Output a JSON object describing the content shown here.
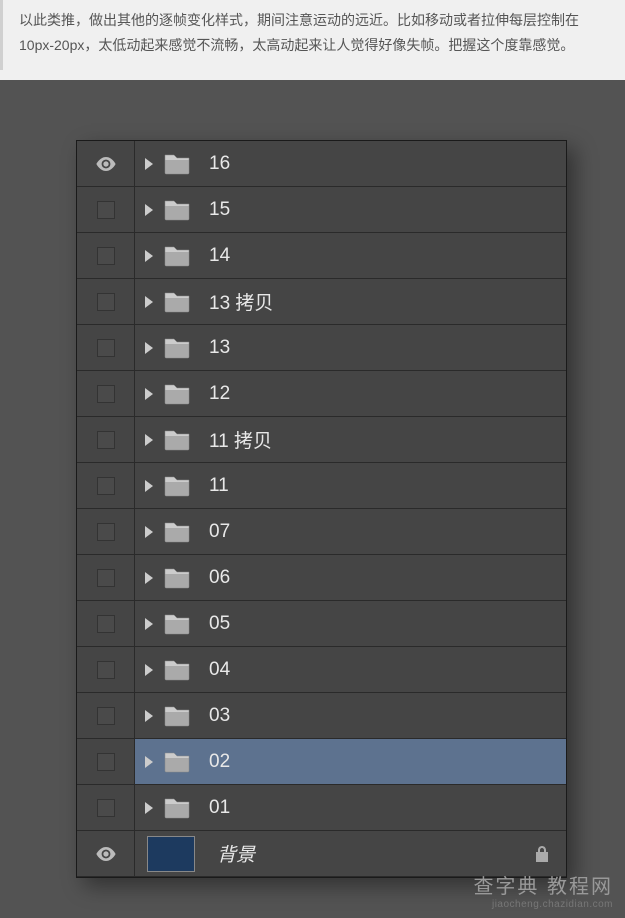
{
  "article": {
    "text": "以此类推，做出其他的逐帧变化样式，期间注意运动的远近。比如移动或者拉伸每层控制在10px-20px，太低动起来感觉不流畅，太高动起来让人觉得好像失帧。把握这个度靠感觉。"
  },
  "layers": [
    {
      "visible": true,
      "name": "16",
      "selected": false,
      "type": "folder"
    },
    {
      "visible": false,
      "name": "15",
      "selected": false,
      "type": "folder"
    },
    {
      "visible": false,
      "name": "14",
      "selected": false,
      "type": "folder"
    },
    {
      "visible": false,
      "name": "13 拷贝",
      "selected": false,
      "type": "folder"
    },
    {
      "visible": false,
      "name": "13",
      "selected": false,
      "type": "folder"
    },
    {
      "visible": false,
      "name": "12",
      "selected": false,
      "type": "folder"
    },
    {
      "visible": false,
      "name": "11 拷贝",
      "selected": false,
      "type": "folder"
    },
    {
      "visible": false,
      "name": "11",
      "selected": false,
      "type": "folder"
    },
    {
      "visible": false,
      "name": "07",
      "selected": false,
      "type": "folder"
    },
    {
      "visible": false,
      "name": "06",
      "selected": false,
      "type": "folder"
    },
    {
      "visible": false,
      "name": "05",
      "selected": false,
      "type": "folder"
    },
    {
      "visible": false,
      "name": "04",
      "selected": false,
      "type": "folder"
    },
    {
      "visible": false,
      "name": "03",
      "selected": false,
      "type": "folder"
    },
    {
      "visible": false,
      "name": "02",
      "selected": true,
      "type": "folder"
    },
    {
      "visible": false,
      "name": "01",
      "selected": false,
      "type": "folder"
    },
    {
      "visible": true,
      "name": "背景",
      "selected": false,
      "type": "background",
      "locked": true
    }
  ],
  "watermark": {
    "main": "查字典 教程网",
    "sub": "jiaocheng.chazidian.com"
  }
}
